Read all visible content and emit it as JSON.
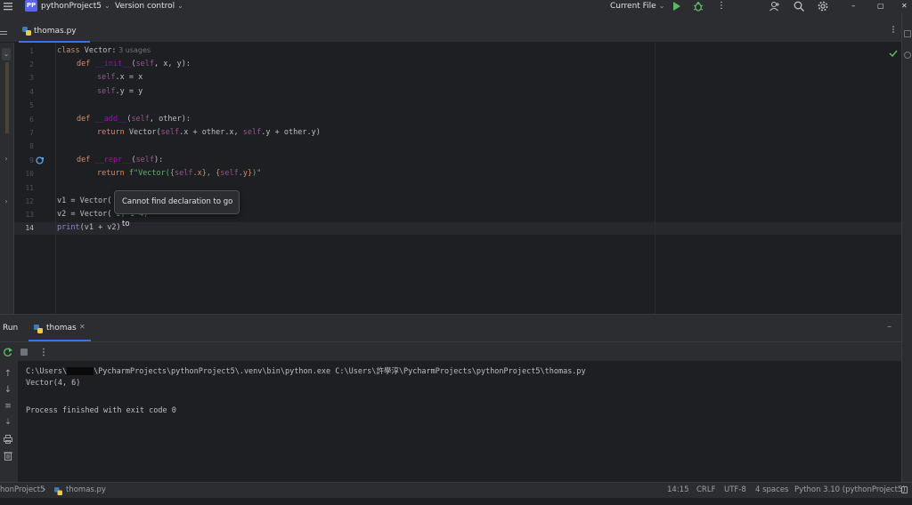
{
  "titlebar": {
    "project_badge": "PP",
    "project_name": "pythonProject5",
    "vcs_label": "Version control",
    "run_config": "Current File",
    "more": "⋮",
    "minimize": "–",
    "restore": "▢",
    "close": "✕"
  },
  "tabs": [
    {
      "label": "thomas.py"
    }
  ],
  "editor": {
    "lines": [
      "1",
      "2",
      "3",
      "4",
      "5",
      "6",
      "7",
      "8",
      "9",
      "10",
      "11",
      "12",
      "13",
      "14"
    ],
    "usages_hint": "3 usages",
    "tooltip": "Cannot find declaration to go to",
    "code": {
      "l1_class": "class ",
      "l1_name": "Vector:",
      "l2_def": "def ",
      "l2_name": "__init__",
      "l2_rest_a": "(",
      "l2_self": "self",
      "l2_rest_b": ", x, y):",
      "l3_self": "self",
      "l3_rest": ".x = x",
      "l4_self": "self",
      "l4_rest": ".y = y",
      "l6_def": "def ",
      "l6_name": "__add__",
      "l6_rest_a": "(",
      "l6_self": "self",
      "l6_rest_b": ", other):",
      "l7_return": "return ",
      "l7_a": "Vector(",
      "l7_self1": "self",
      "l7_b": ".x + other.x, ",
      "l7_self2": "self",
      "l7_c": ".y + other.y)",
      "l9_def": "def ",
      "l9_name": "__repr__",
      "l9_rest_a": "(",
      "l9_self": "self",
      "l9_rest_b": "):",
      "l10_return": "return ",
      "l10_str_a": "f\"Vector(",
      "l10_b1": "{",
      "l10_self1": "self",
      "l10_b2": ".x}",
      "l10_str_b": ", ",
      "l10_b3": "{",
      "l10_self2": "self",
      "l10_b4": ".y}",
      "l10_str_c": ")\"",
      "l12": "v1 = Vector(",
      "l13": "v2 = Vector(",
      "l13_hidden": " 2, 1 4)",
      "l14_print": "print",
      "l14_rest": "(v1 + v2)"
    }
  },
  "run_panel": {
    "title": "Run",
    "tab_label": "thomas",
    "console_lines": [
      "C:\\Users\\",
      "\\PycharmProjects\\pythonProject5\\.venv\\bin\\python.exe C:\\Users\\許學淳\\PycharmProjects\\pythonProject5\\thomas.py",
      "Vector(4, 6)",
      "Process finished with exit code 0"
    ]
  },
  "statusbar": {
    "breadcrumb_project": "honProject5",
    "breadcrumb_file": "thomas.py",
    "position": "14:15",
    "line_endings": "CRLF",
    "encoding": "UTF-8",
    "indent": "4 spaces",
    "interpreter": "Python 3.10 (pythonProject5)"
  },
  "colors": {
    "accent": "#3574f0",
    "background": "#1e1f22",
    "panel": "#2b2d30",
    "keyword": "#cf8e6d",
    "string": "#6aab73",
    "self": "#94558d",
    "dunder": "#b200b2",
    "run_green": "#5fb865"
  },
  "icons": [
    "hamburger-menu-icon",
    "chevron-down-icon",
    "run-icon",
    "debug-icon",
    "add-user-icon",
    "search-icon",
    "settings-icon",
    "python-file-icon",
    "close-tab-icon",
    "folder-icon",
    "rerun-icon",
    "stop-icon",
    "scroll-up-icon",
    "scroll-down-icon",
    "soft-wrap-icon",
    "scroll-to-end-icon",
    "print-icon",
    "trash-icon",
    "check-icon",
    "override-gutter-icon"
  ]
}
